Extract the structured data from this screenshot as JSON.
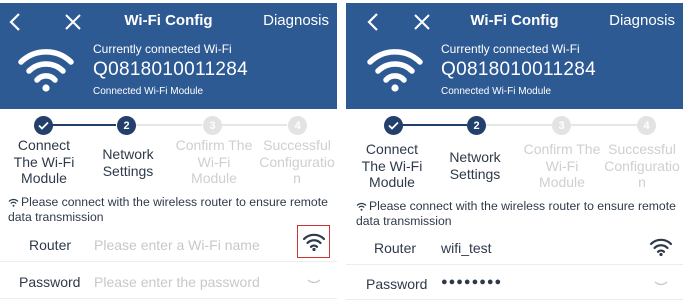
{
  "left": {
    "header": {
      "title": "Wi-Fi Config",
      "diagnosis": "Diagnosis",
      "connected_label": "Currently connected Wi-Fi",
      "connected_ssid": "Q0818010011284",
      "connected_module": "Connected Wi-Fi Module"
    },
    "steps": [
      {
        "number": "",
        "lines": [
          "Connect",
          "The Wi-Fi",
          "Module"
        ],
        "state": "done"
      },
      {
        "number": "2",
        "lines": [
          "Network",
          "Settings"
        ],
        "state": "active"
      },
      {
        "number": "3",
        "lines": [
          "Confirm The",
          "Wi-Fi",
          "Module"
        ],
        "state": "pending"
      },
      {
        "number": "4",
        "lines": [
          "Successful",
          "Configuratio",
          "n"
        ],
        "state": "pending"
      }
    ],
    "hint": "Please connect with the wireless router to ensure remote data transmission",
    "router": {
      "label": "Router",
      "value": "",
      "placeholder": "Please enter a Wi-Fi name"
    },
    "password": {
      "label": "Password",
      "value": "",
      "placeholder": "Please enter the password"
    }
  },
  "right": {
    "header": {
      "title": "Wi-Fi Config",
      "diagnosis": "Diagnosis",
      "connected_label": "Currently connected Wi-Fi",
      "connected_ssid": "Q0818010011284",
      "connected_module": "Connected Wi-Fi Module"
    },
    "steps": [
      {
        "number": "",
        "lines": [
          "Connect",
          "The Wi-Fi",
          "Module"
        ],
        "state": "done"
      },
      {
        "number": "2",
        "lines": [
          "Network",
          "Settings"
        ],
        "state": "active"
      },
      {
        "number": "3",
        "lines": [
          "Confirm The",
          "Wi-Fi",
          "Module"
        ],
        "state": "pending"
      },
      {
        "number": "4",
        "lines": [
          "Successful",
          "Configuratio",
          "n"
        ],
        "state": "pending"
      }
    ],
    "hint": "Please connect with the wireless router to ensure remote data transmission",
    "router": {
      "label": "Router",
      "value": "wifi_test",
      "placeholder": ""
    },
    "password": {
      "label": "Password",
      "value": "●●●●●●●●",
      "placeholder": ""
    }
  },
  "colors": {
    "header_bg": "#2e5a94",
    "step_active": "#233f6b",
    "step_pending": "#e3e3e3",
    "highlight_box": "#cc3333"
  },
  "icons": {
    "back": "chevron-left-icon",
    "close": "close-icon",
    "wifi": "wifi-icon",
    "check": "check-icon",
    "eye": "eye-closed-icon"
  }
}
